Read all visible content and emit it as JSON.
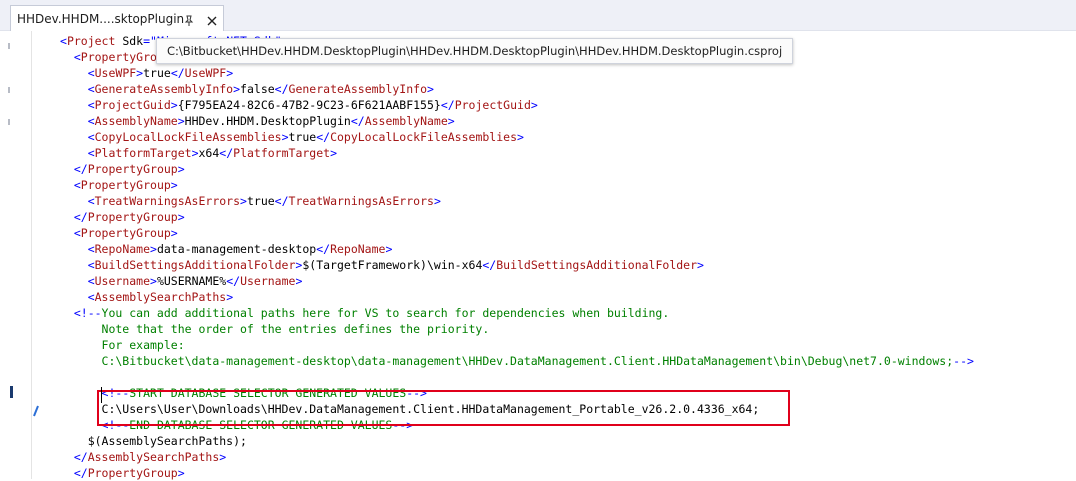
{
  "tab": {
    "title": "HHDev.HHDM....sktopPlugin",
    "pin_icon": "pin-icon",
    "close_icon": "close-icon"
  },
  "tooltip": {
    "text": "C:\\Bitbucket\\HHDev.HHDM.DesktopPlugin\\HHDev.HHDM.DesktopPlugin\\HHDev.HHDM.DesktopPlugin.csproj"
  },
  "colors": {
    "tag": "#a31515",
    "bracket": "#0000ff",
    "comment": "#008000",
    "text": "#000000",
    "highlight_box": "#e0001b"
  },
  "editor": {
    "lines": [
      [
        {
          "t": "b",
          "v": "<"
        },
        {
          "t": "g",
          "v": "Project"
        },
        {
          "t": "x",
          "v": " Sdk"
        },
        {
          "t": "b",
          "v": "=\""
        },
        {
          "t": "b",
          "v": "Microsoft.NET.Sdk"
        },
        {
          "t": "b",
          "v": "\">"
        }
      ],
      [
        {
          "t": "b",
          "v": "  <"
        },
        {
          "t": "g",
          "v": "PropertyGroup"
        },
        {
          "t": "b",
          "v": ">"
        }
      ],
      [
        {
          "t": "b",
          "v": "    <"
        },
        {
          "t": "g",
          "v": "UseWPF"
        },
        {
          "t": "b",
          "v": ">"
        },
        {
          "t": "x",
          "v": "true"
        },
        {
          "t": "b",
          "v": "</"
        },
        {
          "t": "g",
          "v": "UseWPF"
        },
        {
          "t": "b",
          "v": ">"
        }
      ],
      [
        {
          "t": "b",
          "v": "    <"
        },
        {
          "t": "g",
          "v": "GenerateAssemblyInfo"
        },
        {
          "t": "b",
          "v": ">"
        },
        {
          "t": "x",
          "v": "false"
        },
        {
          "t": "b",
          "v": "</"
        },
        {
          "t": "g",
          "v": "GenerateAssemblyInfo"
        },
        {
          "t": "b",
          "v": ">"
        }
      ],
      [
        {
          "t": "b",
          "v": "    <"
        },
        {
          "t": "g",
          "v": "ProjectGuid"
        },
        {
          "t": "b",
          "v": ">"
        },
        {
          "t": "x",
          "v": "{F795EA24-82C6-47B2-9C23-6F621AABF155}"
        },
        {
          "t": "b",
          "v": "</"
        },
        {
          "t": "g",
          "v": "ProjectGuid"
        },
        {
          "t": "b",
          "v": ">"
        }
      ],
      [
        {
          "t": "b",
          "v": "    <"
        },
        {
          "t": "g",
          "v": "AssemblyName"
        },
        {
          "t": "b",
          "v": ">"
        },
        {
          "t": "x",
          "v": "HHDev.HHDM.DesktopPlugin"
        },
        {
          "t": "b",
          "v": "</"
        },
        {
          "t": "g",
          "v": "AssemblyName"
        },
        {
          "t": "b",
          "v": ">"
        }
      ],
      [
        {
          "t": "b",
          "v": "    <"
        },
        {
          "t": "g",
          "v": "CopyLocalLockFileAssemblies"
        },
        {
          "t": "b",
          "v": ">"
        },
        {
          "t": "x",
          "v": "true"
        },
        {
          "t": "b",
          "v": "</"
        },
        {
          "t": "g",
          "v": "CopyLocalLockFileAssemblies"
        },
        {
          "t": "b",
          "v": ">"
        }
      ],
      [
        {
          "t": "b",
          "v": "    <"
        },
        {
          "t": "g",
          "v": "PlatformTarget"
        },
        {
          "t": "b",
          "v": ">"
        },
        {
          "t": "x",
          "v": "x64"
        },
        {
          "t": "b",
          "v": "</"
        },
        {
          "t": "g",
          "v": "PlatformTarget"
        },
        {
          "t": "b",
          "v": ">"
        }
      ],
      [
        {
          "t": "b",
          "v": "  </"
        },
        {
          "t": "g",
          "v": "PropertyGroup"
        },
        {
          "t": "b",
          "v": ">"
        }
      ],
      [
        {
          "t": "b",
          "v": "  <"
        },
        {
          "t": "g",
          "v": "PropertyGroup"
        },
        {
          "t": "b",
          "v": ">"
        }
      ],
      [
        {
          "t": "b",
          "v": "    <"
        },
        {
          "t": "g",
          "v": "TreatWarningsAsErrors"
        },
        {
          "t": "b",
          "v": ">"
        },
        {
          "t": "x",
          "v": "true"
        },
        {
          "t": "b",
          "v": "</"
        },
        {
          "t": "g",
          "v": "TreatWarningsAsErrors"
        },
        {
          "t": "b",
          "v": ">"
        }
      ],
      [
        {
          "t": "b",
          "v": "  </"
        },
        {
          "t": "g",
          "v": "PropertyGroup"
        },
        {
          "t": "b",
          "v": ">"
        }
      ],
      [
        {
          "t": "b",
          "v": "  <"
        },
        {
          "t": "g",
          "v": "PropertyGroup"
        },
        {
          "t": "b",
          "v": ">"
        }
      ],
      [
        {
          "t": "b",
          "v": "    <"
        },
        {
          "t": "g",
          "v": "RepoName"
        },
        {
          "t": "b",
          "v": ">"
        },
        {
          "t": "x",
          "v": "data-management-desktop"
        },
        {
          "t": "b",
          "v": "</"
        },
        {
          "t": "g",
          "v": "RepoName"
        },
        {
          "t": "b",
          "v": ">"
        }
      ],
      [
        {
          "t": "b",
          "v": "    <"
        },
        {
          "t": "g",
          "v": "BuildSettingsAdditionalFolder"
        },
        {
          "t": "b",
          "v": ">"
        },
        {
          "t": "x",
          "v": "$(TargetFramework)\\win-x64"
        },
        {
          "t": "b",
          "v": "</"
        },
        {
          "t": "g",
          "v": "BuildSettingsAdditionalFolder"
        },
        {
          "t": "b",
          "v": ">"
        }
      ],
      [
        {
          "t": "b",
          "v": "    <"
        },
        {
          "t": "g",
          "v": "Username"
        },
        {
          "t": "b",
          "v": ">"
        },
        {
          "t": "x",
          "v": "%USERNAME%"
        },
        {
          "t": "b",
          "v": "</"
        },
        {
          "t": "g",
          "v": "Username"
        },
        {
          "t": "b",
          "v": ">"
        }
      ],
      [
        {
          "t": "b",
          "v": "    <"
        },
        {
          "t": "g",
          "v": "AssemblySearchPaths"
        },
        {
          "t": "b",
          "v": ">"
        }
      ],
      [
        {
          "t": "b",
          "v": "  <!--"
        },
        {
          "t": "c",
          "v": "You can add additional paths here for VS to search for dependencies when building."
        }
      ],
      [
        {
          "t": "c",
          "v": "      Note that the order of the entries defines the priority."
        }
      ],
      [
        {
          "t": "c",
          "v": "      For example:"
        }
      ],
      [
        {
          "t": "c",
          "v": "      C:\\Bitbucket\\data-management-desktop\\data-management\\HHDev.DataManagement.Client.HHDataManagement\\bin\\Debug\\net7.0-windows;"
        },
        {
          "t": "b",
          "v": "-->"
        }
      ],
      [],
      [
        {
          "t": "x",
          "v": "      "
        },
        {
          "t": "b",
          "v": "<!--"
        },
        {
          "t": "c",
          "v": "START DATABASE SELECTOR GENERATED VALUES"
        },
        {
          "t": "b",
          "v": "-->"
        }
      ],
      [
        {
          "t": "x",
          "v": "      C:\\Users\\User\\Downloads\\HHDev.DataManagement.Client.HHDataManagement_Portable_v26.2.0.4336_x64;"
        }
      ],
      [
        {
          "t": "x",
          "v": "      "
        },
        {
          "t": "b",
          "v": "<!--"
        },
        {
          "t": "c",
          "v": "END DATABASE SELECTOR GENERATED VALUES"
        },
        {
          "t": "b",
          "v": "-->"
        }
      ],
      [
        {
          "t": "x",
          "v": "    $(AssemblySearchPaths);"
        }
      ],
      [
        {
          "t": "b",
          "v": "  </"
        },
        {
          "t": "g",
          "v": "AssemblySearchPaths"
        },
        {
          "t": "b",
          "v": ">"
        }
      ],
      [
        {
          "t": "b",
          "v": "  </"
        },
        {
          "t": "g",
          "v": "PropertyGroup"
        },
        {
          "t": "b",
          "v": ">"
        }
      ]
    ]
  }
}
